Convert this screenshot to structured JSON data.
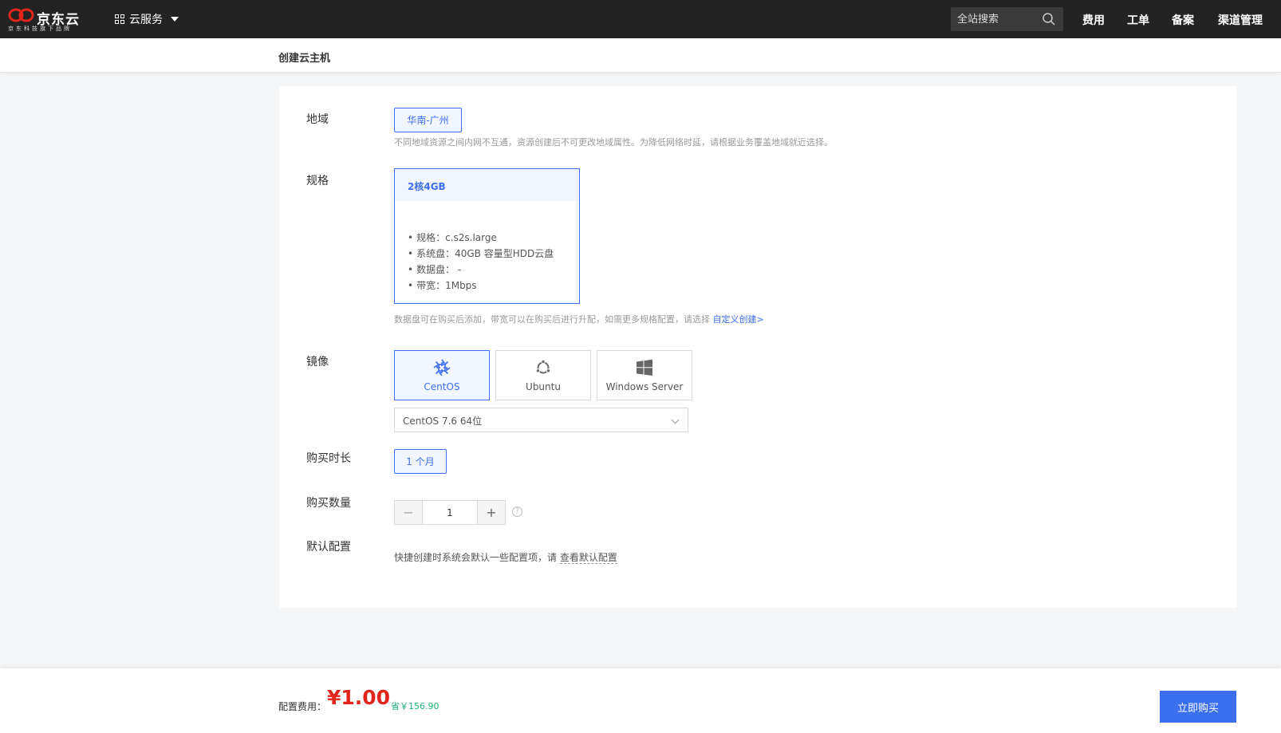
{
  "topbar": {
    "logo_name": "京东云",
    "logo_sub": "京东科技旗下品牌",
    "service_menu": "云服务",
    "search_placeholder": "全站搜索",
    "links": [
      "费用",
      "工单",
      "备案",
      "渠道管理"
    ]
  },
  "page_title": "创建云主机",
  "form": {
    "region": {
      "label": "地域",
      "option": "华南-广州",
      "hint": "不同地域资源之间内网不互通，资源创建后不可更改地域属性。为降低网络时延，请根据业务覆盖地域就近选择。"
    },
    "spec": {
      "label": "规格",
      "card_title": "2核4GB",
      "items": [
        "规格：c.s2s.large",
        "系统盘：40GB 容量型HDD云盘",
        "数据盘： -",
        "带宽：1Mbps"
      ],
      "hint": "数据盘可在购买后添加，带宽可以在购买后进行升配，如需更多规格配置，请选择",
      "custom_link": "自定义创建>"
    },
    "image": {
      "label": "镜像",
      "options": [
        "CentOS",
        "Ubuntu",
        "Windows Server"
      ],
      "selected_version": "CentOS 7.6 64位"
    },
    "duration": {
      "label": "购买时长",
      "option": "1 个月"
    },
    "quantity": {
      "label": "购买数量",
      "value": "1",
      "minus": "−",
      "plus": "+",
      "help": "?"
    },
    "default_config": {
      "label": "默认配置",
      "text": "快捷创建时系统会默认一些配置项，请",
      "link": "查看默认配置"
    }
  },
  "footer": {
    "fee_label": "配置费用：",
    "price": "¥1.00",
    "saving": "省￥156.90",
    "buy_button": "立即购买"
  },
  "colors": {
    "accent": "#3c6ef0",
    "price": "#e1251b",
    "saving": "#1fb37a",
    "topbar": "#232323"
  }
}
